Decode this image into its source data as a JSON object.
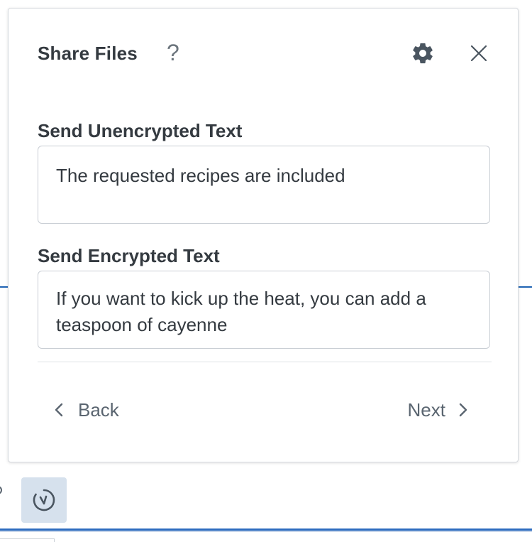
{
  "dialog": {
    "title": "Share Files",
    "help_symbol": "?",
    "icons": {
      "help": "help-icon",
      "settings": "gear-icon",
      "close": "close-icon"
    },
    "unencrypted": {
      "label": "Send Unencrypted Text",
      "value": "The requested recipes are included"
    },
    "encrypted": {
      "label": "Send Encrypted Text",
      "value": "If you want to kick up the heat, you can add a teaspoon of cayenne"
    },
    "footer": {
      "back_label": "Back",
      "next_label": "Next"
    }
  },
  "background": {
    "action_icon": "history-icon"
  },
  "colors": {
    "accent_line": "#1f63b3",
    "text": "#343a40",
    "muted": "#5a6570",
    "action_button_bg": "#d6e1ed"
  }
}
